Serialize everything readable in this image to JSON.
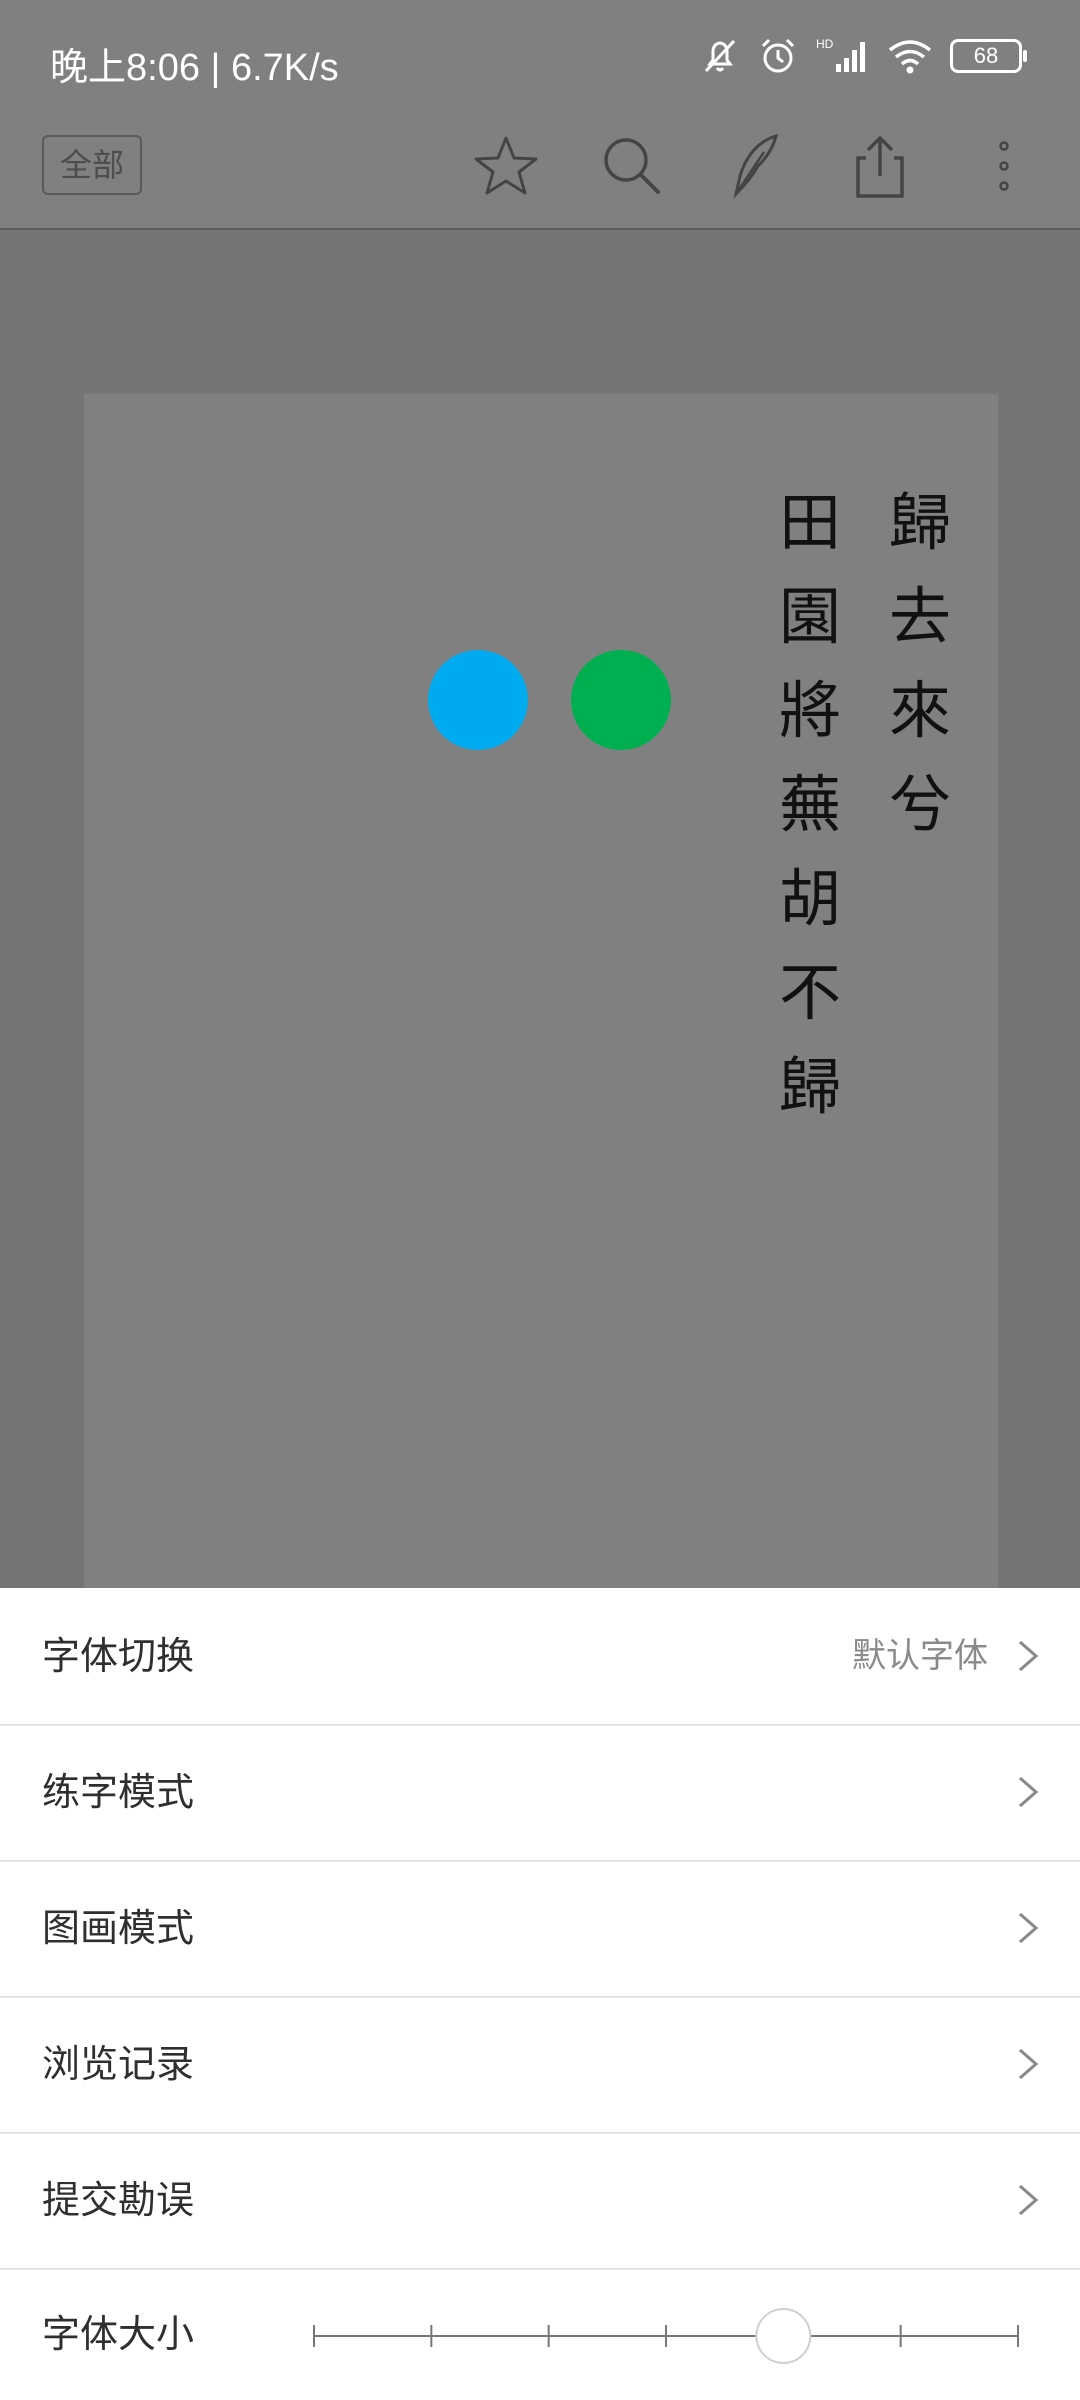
{
  "status_bar": {
    "time_speed": "晚上8:06 | 6.7K/s",
    "battery": "68",
    "icons": [
      "mute-bell-icon",
      "alarm-icon",
      "hd-signal-icon",
      "wifi-icon",
      "battery-icon"
    ]
  },
  "toolbar": {
    "filter_label": "全部",
    "icons": [
      "star-icon",
      "search-icon",
      "quill-icon",
      "share-icon",
      "more-vertical-icon"
    ]
  },
  "page": {
    "column_right": [
      "歸",
      "去",
      "來",
      "兮"
    ],
    "column_left": [
      "田",
      "園",
      "將",
      "蕪",
      "胡",
      "不",
      "歸"
    ],
    "dot_colors": [
      "#00aaee",
      "#00b050"
    ]
  },
  "menu": {
    "items": [
      {
        "label": "字体切换",
        "value": "默认字体"
      },
      {
        "label": "练字模式",
        "value": ""
      },
      {
        "label": "图画模式",
        "value": ""
      },
      {
        "label": "浏览记录",
        "value": ""
      },
      {
        "label": "提交勘误",
        "value": ""
      }
    ],
    "font_size": {
      "label": "字体大小",
      "steps": 7,
      "current_index": 4
    }
  }
}
